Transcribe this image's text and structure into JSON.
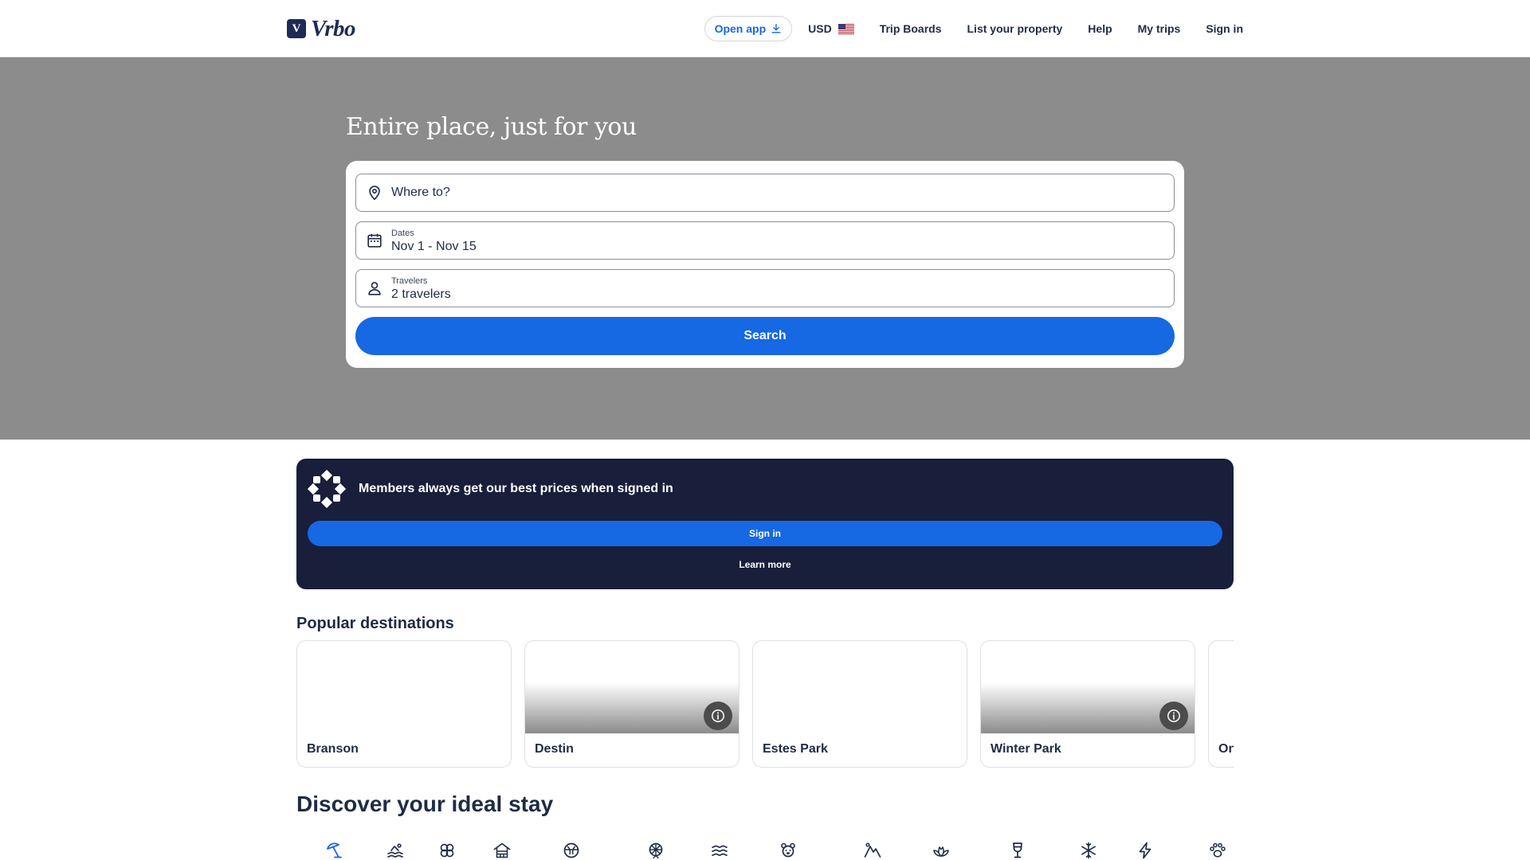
{
  "header": {
    "brand": "Vrbo",
    "open_app": "Open app",
    "currency": "USD",
    "nav": [
      "Trip Boards",
      "List your property",
      "Help",
      "My trips",
      "Sign in"
    ]
  },
  "hero": {
    "title": "Entire place, just for you",
    "destination_placeholder": "Where to?",
    "dates_label": "Dates",
    "dates_value": "Nov 1 - Nov 15",
    "travelers_label": "Travelers",
    "travelers_value": "2 travelers",
    "search_label": "Search"
  },
  "members": {
    "text": "Members always get our best prices when signed in",
    "signin": "Sign in",
    "learn_more": "Learn more"
  },
  "popular": {
    "title": "Popular destinations",
    "destinations": [
      "Branson",
      "Destin",
      "Estes Park",
      "Winter Park",
      "On"
    ]
  },
  "discover": {
    "title": "Discover your ideal stay",
    "icons": [
      "beach-umbrella-icon",
      "pool-icon",
      "flower-icon",
      "cabin-icon",
      "golf-icon",
      "ferris-wheel-icon",
      "lake-icon",
      "pet-bear-icon",
      "mountain-icon",
      "spa-lotus-icon",
      "wine-glass-icon",
      "snowflake-icon",
      "lightning-icon",
      "pet-paw-icon"
    ]
  },
  "colors": {
    "brand_blue": "#1668e3",
    "navy": "#191e3b",
    "text": "#1f2b45",
    "hero_bg": "#8c8c8c"
  }
}
